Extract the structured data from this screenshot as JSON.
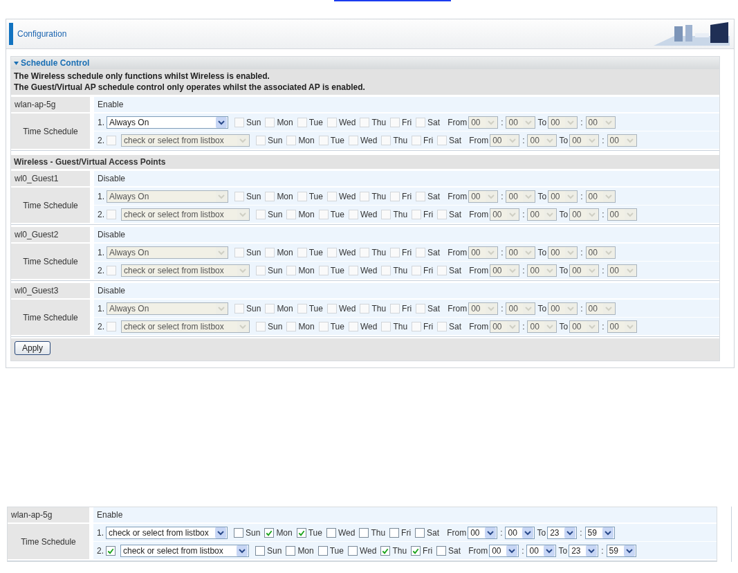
{
  "header": {
    "title": "Configuration"
  },
  "section": {
    "title": "Schedule Control",
    "notes": [
      "The Wireless schedule only functions whilst Wireless is enabled.",
      "The Guest/Virtual AP schedule control only operates whilst the associated AP is enabled."
    ]
  },
  "access_points": [
    {
      "name": "wlan-ap-5g",
      "status": "Enable",
      "schedule_label": "Time Schedule",
      "rows": [
        {
          "number": "1.",
          "kind": "fixed",
          "mode": "Always On",
          "select_disabled": false,
          "times_disabled": true,
          "days": [
            {
              "label": "Sun",
              "checked": false
            },
            {
              "label": "Mon",
              "checked": false
            },
            {
              "label": "Tue",
              "checked": false
            },
            {
              "label": "Wed",
              "checked": false
            },
            {
              "label": "Thu",
              "checked": false
            },
            {
              "label": "Fri",
              "checked": false
            },
            {
              "label": "Sat",
              "checked": false
            }
          ],
          "from_label": "From",
          "from_hour": "00",
          "from_sep": ":",
          "from_minute": "00",
          "to_label": "To",
          "to_hour": "00",
          "to_sep": ":",
          "to_minute": "00"
        },
        {
          "number": "2.",
          "kind": "optional",
          "checked": false,
          "mode": "check or select from listbox",
          "select_disabled": true,
          "times_disabled": true,
          "days": [
            {
              "label": "Sun",
              "checked": false
            },
            {
              "label": "Mon",
              "checked": false
            },
            {
              "label": "Tue",
              "checked": false
            },
            {
              "label": "Wed",
              "checked": false
            },
            {
              "label": "Thu",
              "checked": false
            },
            {
              "label": "Fri",
              "checked": false
            },
            {
              "label": "Sat",
              "checked": false
            }
          ],
          "from_label": "From",
          "from_hour": "00",
          "from_sep": ":",
          "from_minute": "00",
          "to_label": "To",
          "to_hour": "00",
          "to_sep": ":",
          "to_minute": "00"
        }
      ]
    }
  ],
  "guest_heading": "Wireless - Guest/Virtual Access Points",
  "guest_access_points": [
    {
      "name": "wl0_Guest1",
      "status": "Disable",
      "schedule_label": "Time Schedule",
      "rows": [
        {
          "number": "1.",
          "kind": "fixed",
          "mode": "Always On",
          "select_disabled": true,
          "times_disabled": true,
          "days": [
            {
              "label": "Sun",
              "checked": false
            },
            {
              "label": "Mon",
              "checked": false
            },
            {
              "label": "Tue",
              "checked": false
            },
            {
              "label": "Wed",
              "checked": false
            },
            {
              "label": "Thu",
              "checked": false
            },
            {
              "label": "Fri",
              "checked": false
            },
            {
              "label": "Sat",
              "checked": false
            }
          ],
          "from_label": "From",
          "from_hour": "00",
          "from_sep": ":",
          "from_minute": "00",
          "to_label": "To",
          "to_hour": "00",
          "to_sep": ":",
          "to_minute": "00"
        },
        {
          "number": "2.",
          "kind": "optional",
          "checked": false,
          "mode": "check or select from listbox",
          "select_disabled": true,
          "times_disabled": true,
          "days": [
            {
              "label": "Sun",
              "checked": false
            },
            {
              "label": "Mon",
              "checked": false
            },
            {
              "label": "Tue",
              "checked": false
            },
            {
              "label": "Wed",
              "checked": false
            },
            {
              "label": "Thu",
              "checked": false
            },
            {
              "label": "Fri",
              "checked": false
            },
            {
              "label": "Sat",
              "checked": false
            }
          ],
          "from_label": "From",
          "from_hour": "00",
          "from_sep": ":",
          "from_minute": "00",
          "to_label": "To",
          "to_hour": "00",
          "to_sep": ":",
          "to_minute": "00"
        }
      ]
    },
    {
      "name": "wl0_Guest2",
      "status": "Disable",
      "schedule_label": "Time Schedule",
      "rows": [
        {
          "number": "1.",
          "kind": "fixed",
          "mode": "Always On",
          "select_disabled": true,
          "times_disabled": true,
          "days": [
            {
              "label": "Sun",
              "checked": false
            },
            {
              "label": "Mon",
              "checked": false
            },
            {
              "label": "Tue",
              "checked": false
            },
            {
              "label": "Wed",
              "checked": false
            },
            {
              "label": "Thu",
              "checked": false
            },
            {
              "label": "Fri",
              "checked": false
            },
            {
              "label": "Sat",
              "checked": false
            }
          ],
          "from_label": "From",
          "from_hour": "00",
          "from_sep": ":",
          "from_minute": "00",
          "to_label": "To",
          "to_hour": "00",
          "to_sep": ":",
          "to_minute": "00"
        },
        {
          "number": "2.",
          "kind": "optional",
          "checked": false,
          "mode": "check or select from listbox",
          "select_disabled": true,
          "times_disabled": true,
          "days": [
            {
              "label": "Sun",
              "checked": false
            },
            {
              "label": "Mon",
              "checked": false
            },
            {
              "label": "Tue",
              "checked": false
            },
            {
              "label": "Wed",
              "checked": false
            },
            {
              "label": "Thu",
              "checked": false
            },
            {
              "label": "Fri",
              "checked": false
            },
            {
              "label": "Sat",
              "checked": false
            }
          ],
          "from_label": "From",
          "from_hour": "00",
          "from_sep": ":",
          "from_minute": "00",
          "to_label": "To",
          "to_hour": "00",
          "to_sep": ":",
          "to_minute": "00"
        }
      ]
    },
    {
      "name": "wl0_Guest3",
      "status": "Disable",
      "schedule_label": "Time Schedule",
      "rows": [
        {
          "number": "1.",
          "kind": "fixed",
          "mode": "Always On",
          "select_disabled": true,
          "times_disabled": true,
          "days": [
            {
              "label": "Sun",
              "checked": false
            },
            {
              "label": "Mon",
              "checked": false
            },
            {
              "label": "Tue",
              "checked": false
            },
            {
              "label": "Wed",
              "checked": false
            },
            {
              "label": "Thu",
              "checked": false
            },
            {
              "label": "Fri",
              "checked": false
            },
            {
              "label": "Sat",
              "checked": false
            }
          ],
          "from_label": "From",
          "from_hour": "00",
          "from_sep": ":",
          "from_minute": "00",
          "to_label": "To",
          "to_hour": "00",
          "to_sep": ":",
          "to_minute": "00"
        },
        {
          "number": "2.",
          "kind": "optional",
          "checked": false,
          "mode": "check or select from listbox",
          "select_disabled": true,
          "times_disabled": true,
          "days": [
            {
              "label": "Sun",
              "checked": false
            },
            {
              "label": "Mon",
              "checked": false
            },
            {
              "label": "Tue",
              "checked": false
            },
            {
              "label": "Wed",
              "checked": false
            },
            {
              "label": "Thu",
              "checked": false
            },
            {
              "label": "Fri",
              "checked": false
            },
            {
              "label": "Sat",
              "checked": false
            }
          ],
          "from_label": "From",
          "from_hour": "00",
          "from_sep": ":",
          "from_minute": "00",
          "to_label": "To",
          "to_hour": "00",
          "to_sep": ":",
          "to_minute": "00"
        }
      ]
    }
  ],
  "apply_button": "Apply",
  "example": {
    "name": "wlan-ap-5g",
    "status": "Enable",
    "schedule_label": "Time Schedule",
    "rows": [
      {
        "number": "1.",
        "kind": "fixed",
        "mode": "check or select from listbox",
        "select_disabled": false,
        "times_disabled": false,
        "days": [
          {
            "label": "Sun",
            "checked": false
          },
          {
            "label": "Mon",
            "checked": true
          },
          {
            "label": "Tue",
            "checked": true
          },
          {
            "label": "Wed",
            "checked": false
          },
          {
            "label": "Thu",
            "checked": false
          },
          {
            "label": "Fri",
            "checked": false
          },
          {
            "label": "Sat",
            "checked": false
          }
        ],
        "from_label": "From",
        "from_hour": "00",
        "from_sep": ":",
        "from_minute": "00",
        "to_label": "To",
        "to_hour": "23",
        "to_sep": ":",
        "to_minute": "59"
      },
      {
        "number": "2.",
        "kind": "optional",
        "checked": true,
        "mode": "check or select from listbox",
        "select_disabled": false,
        "times_disabled": false,
        "days": [
          {
            "label": "Sun",
            "checked": false
          },
          {
            "label": "Mon",
            "checked": false
          },
          {
            "label": "Tue",
            "checked": false
          },
          {
            "label": "Wed",
            "checked": false
          },
          {
            "label": "Thu",
            "checked": true
          },
          {
            "label": "Fri",
            "checked": true
          },
          {
            "label": "Sat",
            "checked": false
          }
        ],
        "from_label": "From",
        "from_hour": "00",
        "from_sep": ":",
        "from_minute": "00",
        "to_label": "To",
        "to_hour": "23",
        "to_sep": ":",
        "to_minute": "59"
      }
    ]
  }
}
